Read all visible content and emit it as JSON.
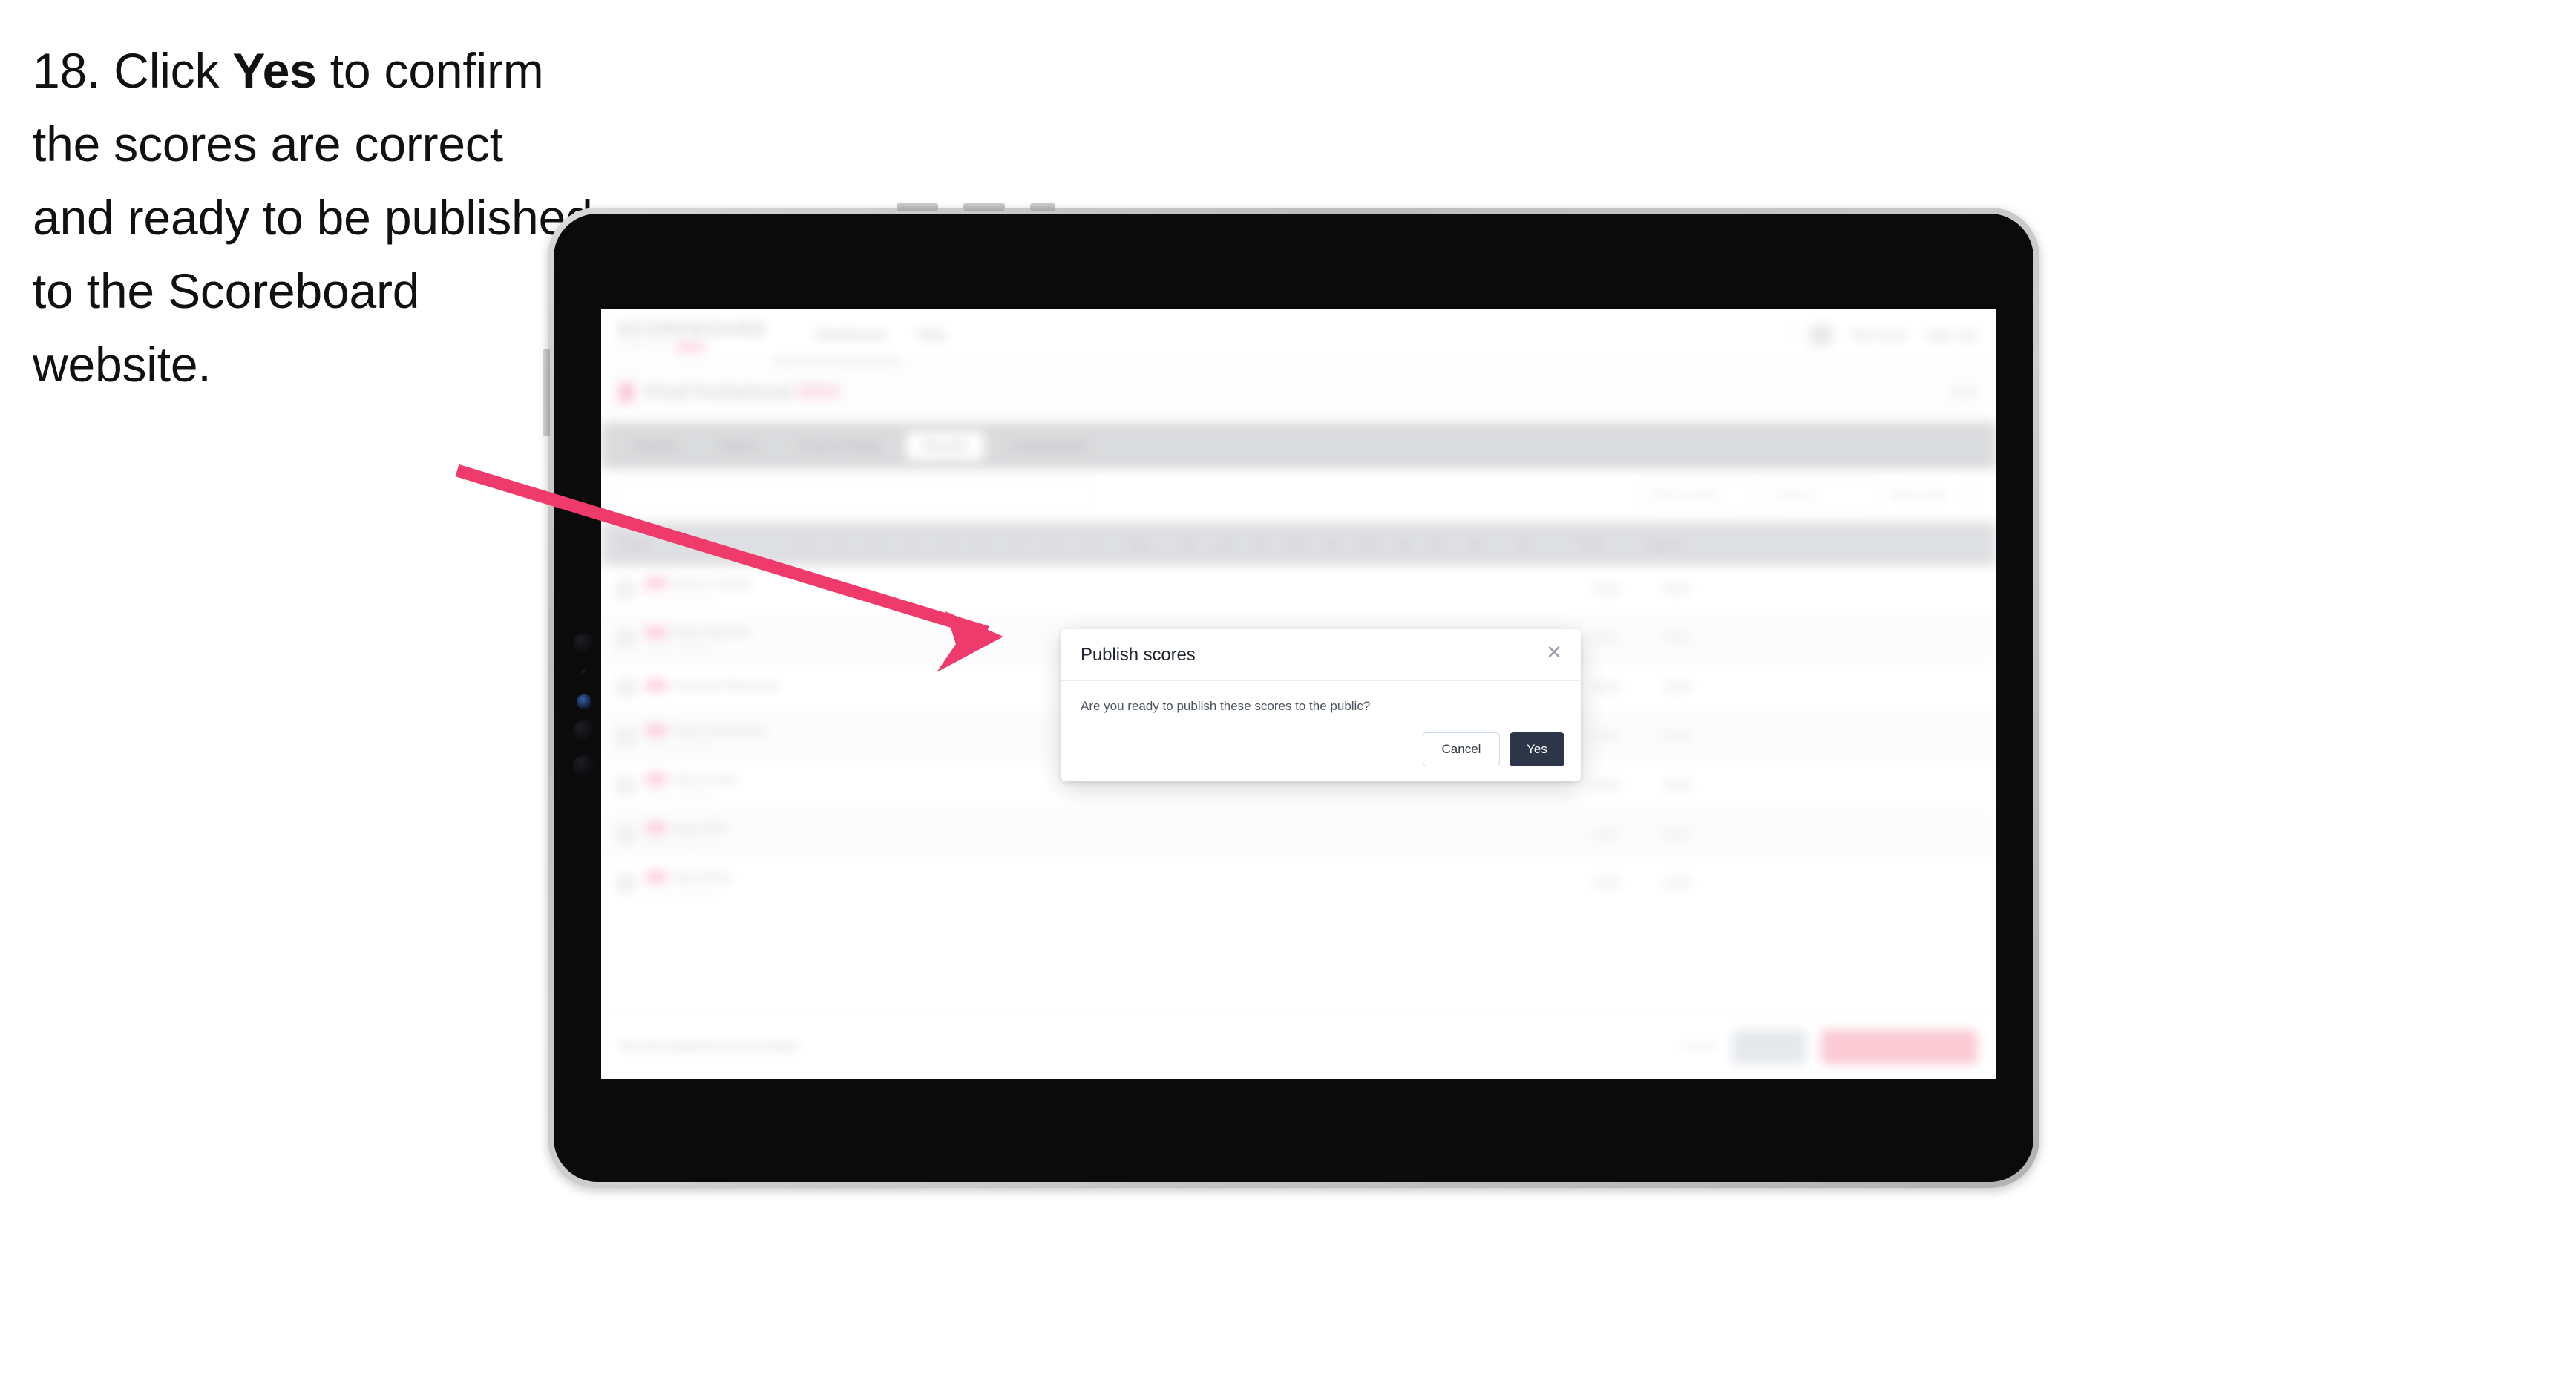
{
  "caption": {
    "prefix": "18. Click ",
    "bold": "Yes",
    "suffix": " to confirm the scores are correct and ready to be published to the Scoreboard website."
  },
  "colors": {
    "arrow": "#ef3b6c",
    "yes_button_bg": "#2c3648",
    "cancel_border": "#cdd9ee",
    "tab_strip": "#d7d8da",
    "table_header": "#dcdde0",
    "publish_button": "#fbc5d1"
  },
  "app": {
    "brand": {
      "name": "SCOREBOARD",
      "sub_left": "POWERED BY",
      "chip": ""
    },
    "header_nav": [
      {
        "label": "Dashboard"
      },
      {
        "label": "Help"
      }
    ],
    "header_right": [
      {
        "label": "Test User"
      },
      {
        "label": "Sign out"
      }
    ],
    "subhead": {
      "title": "Final Invitational",
      "year": "2024",
      "right": "Draft"
    },
    "tabs": [
      {
        "label": "Details",
        "active": false
      },
      {
        "label": "Teams",
        "active": false
      },
      {
        "label": "Course Setup",
        "active": false
      },
      {
        "label": "Results",
        "active": true
      },
      {
        "label": "Leaderboard",
        "active": false
      }
    ],
    "filters": {
      "search_placeholder": "Search players",
      "select_one": "Filter by team",
      "select_two": "Round 1",
      "label": "Score entry"
    },
    "table": {
      "columns": [
        {
          "label": "Player",
          "type": "player"
        },
        {
          "label": "1",
          "type": "num"
        },
        {
          "label": "2",
          "type": "num"
        },
        {
          "label": "3",
          "type": "num"
        },
        {
          "label": "4",
          "type": "num"
        },
        {
          "label": "5",
          "type": "num"
        },
        {
          "label": "6",
          "type": "num"
        },
        {
          "label": "7",
          "type": "num"
        },
        {
          "label": "8",
          "type": "num"
        },
        {
          "label": "9",
          "type": "num"
        },
        {
          "label": "Out",
          "type": "wide"
        },
        {
          "label": "10",
          "type": "num"
        },
        {
          "label": "11",
          "type": "num"
        },
        {
          "label": "12",
          "type": "num"
        },
        {
          "label": "13",
          "type": "num"
        },
        {
          "label": "14",
          "type": "num"
        },
        {
          "label": "15",
          "type": "num"
        },
        {
          "label": "16",
          "type": "num"
        },
        {
          "label": "17",
          "type": "num"
        },
        {
          "label": "18",
          "type": "num"
        },
        {
          "label": "In",
          "type": "wide"
        },
        {
          "label": "Total",
          "type": "end"
        },
        {
          "label": "Status",
          "type": "end"
        }
      ],
      "rows": [
        {
          "name": "Marcus Tanaka",
          "sub": "Team A - Division 1"
        },
        {
          "name": "Elena Reynold",
          "sub": "Team B - Division 1"
        },
        {
          "name": "Cameron Robertson",
          "sub": ""
        },
        {
          "name": "Chloe Westerman",
          "sub": "Team C - Division 2"
        },
        {
          "name": "Oliver Grant",
          "sub": "Team D - Division 2"
        },
        {
          "name": "Ryan Mills",
          "sub": "Team E - Division 3"
        },
        {
          "name": "Nate Bailey",
          "sub": "Team F - Division 3"
        }
      ]
    },
    "action_bar": {
      "note": "Results published successfully",
      "link": "Cancel",
      "save_label": "Save",
      "publish_label": "Publish to Scoreboard"
    }
  },
  "modal": {
    "title": "Publish scores",
    "message": "Are you ready to publish these scores to the public?",
    "close_icon": "✕",
    "cancel_label": "Cancel",
    "confirm_label": "Yes"
  }
}
